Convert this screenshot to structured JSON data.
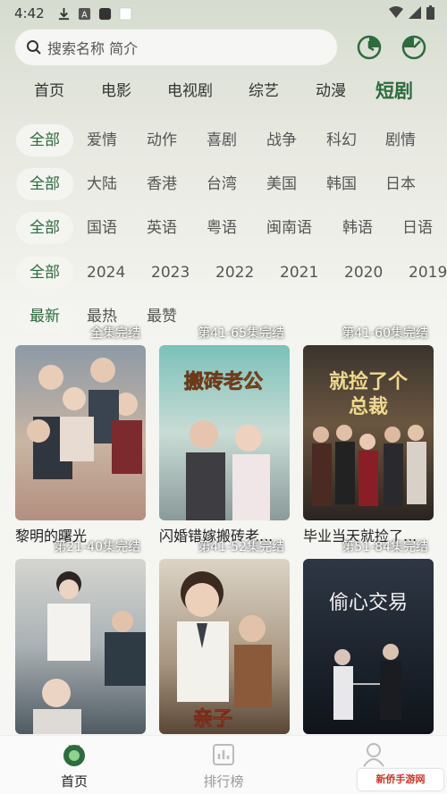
{
  "status": {
    "time": "4:42"
  },
  "search": {
    "placeholder": "搜索名称 简介"
  },
  "categories": [
    "首页",
    "电影",
    "电视剧",
    "综艺",
    "动漫",
    "短剧"
  ],
  "filters": {
    "genre": [
      "全部",
      "爱情",
      "动作",
      "喜剧",
      "战争",
      "科幻",
      "剧情"
    ],
    "region": [
      "全部",
      "大陆",
      "香港",
      "台湾",
      "美国",
      "韩国",
      "日本"
    ],
    "language": [
      "全部",
      "国语",
      "英语",
      "粤语",
      "闽南语",
      "韩语",
      "日语"
    ],
    "year": [
      "全部",
      "2024",
      "2023",
      "2022",
      "2021",
      "2020",
      "2019"
    ],
    "sort": [
      "最新",
      "最热",
      "最赞"
    ]
  },
  "cards": [
    {
      "title": "黎明的曙光",
      "badge": "全集完结",
      "poster_text": "黎明的曙光",
      "colors": [
        "#7a8590",
        "#c7b7a8"
      ]
    },
    {
      "title": "闪婚错嫁搬砖老...",
      "badge": "第41-65集完结",
      "poster_text": "闪婚错嫁 搬砖老公是总裁",
      "colors": [
        "#5fa8a4",
        "#c8d9d2"
      ]
    },
    {
      "title": "毕业当天就捡了...",
      "badge": "第41-60集完结",
      "poster_text": "毕业当天 就捡了个总裁",
      "colors": [
        "#3a3a3a",
        "#b89a6a"
      ]
    },
    {
      "title": "",
      "badge": "第21-40集完结",
      "poster_text": "",
      "colors": [
        "#b9bcc0",
        "#6e7d86"
      ]
    },
    {
      "title": "",
      "badge": "第41-52集完结",
      "poster_text": "",
      "colors": [
        "#c7c0b2",
        "#5e4a3a"
      ]
    },
    {
      "title": "",
      "badge": "第51-84集完结",
      "poster_text": "偷心交易",
      "colors": [
        "#2a3340",
        "#131820"
      ]
    }
  ],
  "nav": [
    "首页",
    "排行榜",
    ""
  ],
  "watermark": "新侨手游网",
  "accent": "#2e6b3e"
}
